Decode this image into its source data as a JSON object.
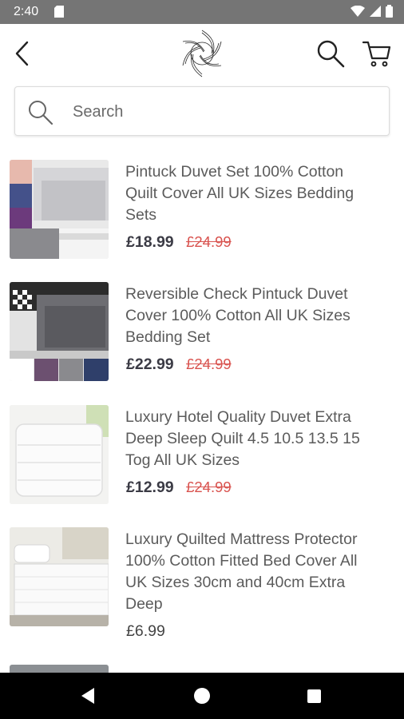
{
  "status_bar": {
    "time": "2:40"
  },
  "header": {
    "back_icon": "chevron-left-icon",
    "logo_icon": "brand-logo",
    "search_icon": "search-icon",
    "cart_icon": "cart-icon"
  },
  "search": {
    "placeholder": "Search",
    "value": ""
  },
  "products": [
    {
      "title": "Pintuck Duvet Set 100% Cotton Quilt Cover All UK Sizes Bedding Sets",
      "price": "£18.99",
      "old_price": "£24.99"
    },
    {
      "title": "Reversible Check Pintuck Duvet Cover 100% Cotton All UK Sizes Bedding Set",
      "price": "£22.99",
      "old_price": "£24.99"
    },
    {
      "title": "Luxury Hotel Quality Duvet Extra Deep Sleep Quilt 4.5 10.5 13.5 15 Tog All UK Sizes",
      "price": "£12.99",
      "old_price": "£24.99"
    },
    {
      "title": "Luxury Quilted Mattress Protector 100% Cotton Fitted Bed Cover All UK Sizes 30cm and 40cm Extra Deep",
      "price": "£6.99",
      "old_price": ""
    }
  ],
  "colors": {
    "accent_old_price": "#d9534f",
    "status_bar": "#757575",
    "nav_bar": "#000000"
  }
}
